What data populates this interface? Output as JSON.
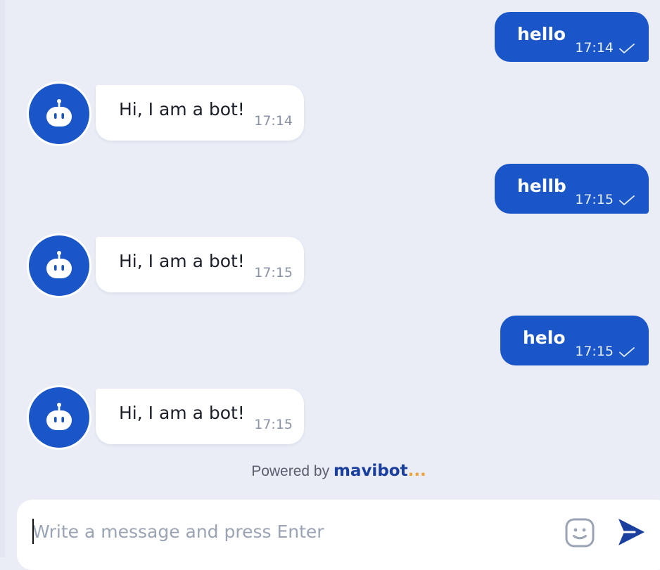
{
  "messages": [
    {
      "from": "user",
      "text": "hello",
      "time": "17:14",
      "status_icon": "check-icon"
    },
    {
      "from": "bot",
      "text": "Hi, I am a bot!",
      "time": "17:14",
      "avatar_icon": "robot-icon"
    },
    {
      "from": "user",
      "text": "hellb",
      "time": "17:15",
      "status_icon": "check-icon"
    },
    {
      "from": "bot",
      "text": "Hi, I am a bot!",
      "time": "17:15",
      "avatar_icon": "robot-icon"
    },
    {
      "from": "user",
      "text": "helo",
      "time": "17:15",
      "status_icon": "check-icon"
    },
    {
      "from": "bot",
      "text": "Hi, I am a bot!",
      "time": "17:15",
      "avatar_icon": "robot-icon"
    }
  ],
  "footer": {
    "powered_prefix": "Powered by",
    "brand": "mavibot",
    "brand_dots": "..."
  },
  "composer": {
    "placeholder": "Write a message and press Enter",
    "value": "",
    "emoji_icon": "emoji-icon",
    "send_icon": "send-icon"
  },
  "colors": {
    "accent": "#1a56c8",
    "background": "#eaedf6",
    "bot_bubble": "#ffffff",
    "brand_dots": "#f0a43a"
  }
}
